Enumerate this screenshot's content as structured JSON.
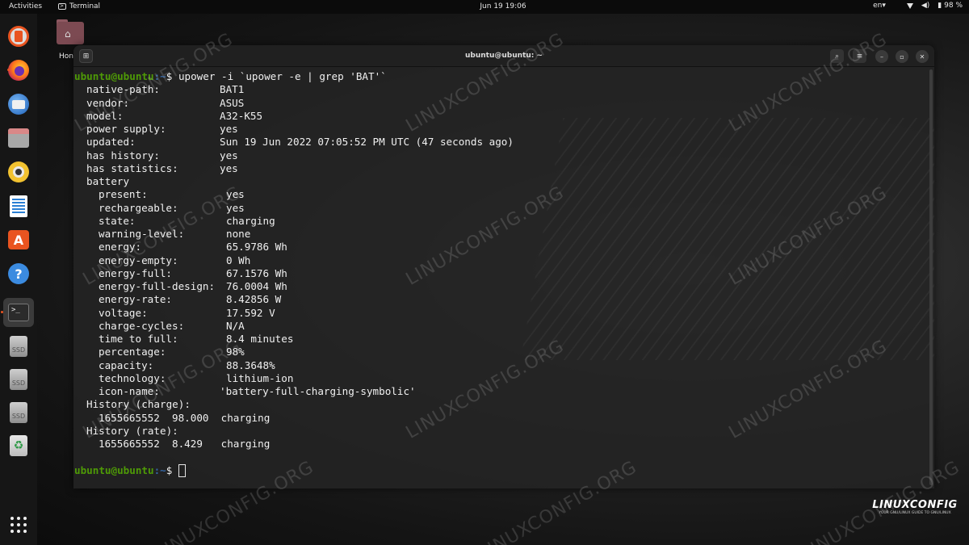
{
  "topbar": {
    "activities": "Activities",
    "app_name": "Terminal",
    "clock": "Jun 19  19:06",
    "lang": "en",
    "battery": "98 %"
  },
  "desktop": {
    "home_label": "Hon"
  },
  "dock": {
    "items": [
      "app-center-icon",
      "firefox-icon",
      "thunderbird-icon",
      "files-icon",
      "rhythmbox-icon",
      "libreoffice-writer-icon",
      "ubuntu-software-icon",
      "help-icon",
      "terminal-icon",
      "ssd-drive-icon",
      "ssd-drive-icon",
      "ssd-drive-icon",
      "trash-icon",
      "show-apps-icon"
    ],
    "ssd_label": "SSD"
  },
  "terminal": {
    "title": "ubuntu@ubuntu: ~",
    "prompt_user": "ubuntu@ubuntu",
    "prompt_path": ":~",
    "prompt_symbol": "$",
    "command": "upower -i `upower -e | grep 'BAT'`",
    "fields": [
      {
        "key": "native-path:",
        "value": "BAT1"
      },
      {
        "key": "vendor:",
        "value": "ASUS"
      },
      {
        "key": "model:",
        "value": "A32-K55"
      },
      {
        "key": "power supply:",
        "value": "yes"
      },
      {
        "key": "updated:",
        "value": "Sun 19 Jun 2022 07:05:52 PM UTC (47 seconds ago)"
      },
      {
        "key": "has history:",
        "value": "yes"
      },
      {
        "key": "has statistics:",
        "value": "yes"
      }
    ],
    "battery_header": "battery",
    "battery_fields": [
      {
        "key": "present:",
        "value": "yes"
      },
      {
        "key": "rechargeable:",
        "value": "yes"
      },
      {
        "key": "state:",
        "value": "charging"
      },
      {
        "key": "warning-level:",
        "value": "none"
      },
      {
        "key": "energy:",
        "value": "65.9786 Wh"
      },
      {
        "key": "energy-empty:",
        "value": "0 Wh"
      },
      {
        "key": "energy-full:",
        "value": "67.1576 Wh"
      },
      {
        "key": "energy-full-design:",
        "value": "76.0004 Wh"
      },
      {
        "key": "energy-rate:",
        "value": "8.42856 W"
      },
      {
        "key": "voltage:",
        "value": "17.592 V"
      },
      {
        "key": "charge-cycles:",
        "value": "N/A"
      },
      {
        "key": "time to full:",
        "value": "8.4 minutes"
      },
      {
        "key": "percentage:",
        "value": "98%"
      },
      {
        "key": "capacity:",
        "value": "88.3648%"
      },
      {
        "key": "technology:",
        "value": "lithium-ion"
      },
      {
        "key": "icon-name:",
        "value": "'battery-full-charging-symbolic'"
      }
    ],
    "history_charge_header": "History (charge):",
    "history_charge_row": "1655665552  98.000  charging",
    "history_rate_header": "History (rate):",
    "history_rate_row": "1655665552  8.429   charging"
  },
  "watermark": "LINUXCONFIG.ORG",
  "brand": {
    "logo": "LINUXCONFIG",
    "tagline": "YOUR GNU/LINUX GUIDE TO GNU/LINUX"
  }
}
